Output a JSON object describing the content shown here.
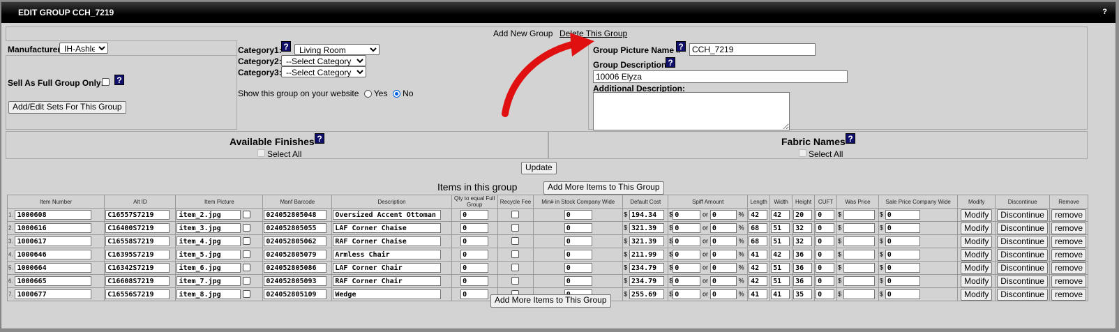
{
  "window": {
    "title": "EDIT GROUP CCH_7219",
    "help": "?"
  },
  "top_links": {
    "add_group": "Add New Group",
    "delete_group": "Delete This Group"
  },
  "manufacturer": {
    "label": "Manufacturer",
    "value": "IH-Ashley"
  },
  "categories": [
    {
      "label": "Category1:",
      "value": "Living Room"
    },
    {
      "label": "Category2:",
      "value": "--Select Category"
    },
    {
      "label": "Category3:",
      "value": "--Select Category"
    }
  ],
  "sell_full": {
    "label": "Sell As Full Group Only:"
  },
  "show_website": {
    "label": "Show this group on your website",
    "yes": "Yes",
    "no": "No",
    "selected": "No"
  },
  "add_sets_button": "Add/Edit Sets For This Group",
  "picture_name": {
    "label": "Group Picture Name #",
    "value": "CCH_7219"
  },
  "description": {
    "label": "Group Description:",
    "value": "10006 Elyza"
  },
  "additional": {
    "label": "Additional Description:",
    "value": ""
  },
  "finishes": {
    "title": "Available Finishes",
    "select_all": "Select All"
  },
  "fabrics": {
    "title": "Fabric Names",
    "select_all": "Select All"
  },
  "update_button": "Update",
  "items_section": {
    "title": "Items in this group",
    "add_more": "Add More Items to This Group",
    "add_more_bottom": "Add More Items to This Group"
  },
  "columns": [
    "Item Number",
    "Alt ID",
    "Item Picture",
    "Manf Barcode",
    "Description",
    "Qty to equal Full Group",
    "Recycle Fee",
    "Min# in Stock Company Wide",
    "Default Cost",
    "Spiff Amount",
    "Length",
    "Width",
    "Height",
    "CUFT",
    "Was Price",
    "Sale Price Company Wide",
    "Modify",
    "Discontinue",
    "Remove"
  ],
  "labels": {
    "currency": "$",
    "or": "or",
    "percent": "%",
    "modify": "Modify",
    "discontinue": "Discontinue",
    "remove": "remove"
  },
  "rows": [
    {
      "n": "1.",
      "item": "1000608",
      "alt": "C16557S7219",
      "pic": "item_2.jpg",
      "barcode": "024052805048",
      "desc": "Oversized Accent Ottoman",
      "qty": "0",
      "min": "0",
      "cost": "194.34",
      "spiff": "0",
      "spiff_pct": "0",
      "len": "42",
      "wid": "42",
      "hgt": "20",
      "cuft": "0",
      "was": "",
      "sale": "0"
    },
    {
      "n": "2.",
      "item": "1000616",
      "alt": "C16400S7219",
      "pic": "item_3.jpg",
      "barcode": "024052805055",
      "desc": "LAF Corner Chaise",
      "qty": "0",
      "min": "0",
      "cost": "321.39",
      "spiff": "0",
      "spiff_pct": "0",
      "len": "68",
      "wid": "51",
      "hgt": "32",
      "cuft": "0",
      "was": "",
      "sale": "0"
    },
    {
      "n": "3.",
      "item": "1000617",
      "alt": "C16558S7219",
      "pic": "item_4.jpg",
      "barcode": "024052805062",
      "desc": "RAF Corner Chaise",
      "qty": "0",
      "min": "0",
      "cost": "321.39",
      "spiff": "0",
      "spiff_pct": "0",
      "len": "68",
      "wid": "51",
      "hgt": "32",
      "cuft": "0",
      "was": "",
      "sale": "0"
    },
    {
      "n": "4.",
      "item": "1000646",
      "alt": "C16395S7219",
      "pic": "item_5.jpg",
      "barcode": "024052805079",
      "desc": "Armless Chair",
      "qty": "0",
      "min": "0",
      "cost": "211.99",
      "spiff": "0",
      "spiff_pct": "0",
      "len": "41",
      "wid": "42",
      "hgt": "36",
      "cuft": "0",
      "was": "",
      "sale": "0"
    },
    {
      "n": "5.",
      "item": "1000664",
      "alt": "C16342S7219",
      "pic": "item_6.jpg",
      "barcode": "024052805086",
      "desc": "LAF Corner Chair",
      "qty": "0",
      "min": "0",
      "cost": "234.79",
      "spiff": "0",
      "spiff_pct": "0",
      "len": "42",
      "wid": "51",
      "hgt": "36",
      "cuft": "0",
      "was": "",
      "sale": "0"
    },
    {
      "n": "6.",
      "item": "1000665",
      "alt": "C16608S7219",
      "pic": "item_7.jpg",
      "barcode": "024052805093",
      "desc": "RAF Corner Chair",
      "qty": "0",
      "min": "0",
      "cost": "234.79",
      "spiff": "0",
      "spiff_pct": "0",
      "len": "42",
      "wid": "51",
      "hgt": "36",
      "cuft": "0",
      "was": "",
      "sale": "0"
    },
    {
      "n": "7.",
      "item": "1000677",
      "alt": "C16556S7219",
      "pic": "item_8.jpg",
      "barcode": "024052805109",
      "desc": "Wedge",
      "qty": "0",
      "min": "0",
      "cost": "255.69",
      "spiff": "0",
      "spiff_pct": "0",
      "len": "41",
      "wid": "41",
      "hgt": "35",
      "cuft": "0",
      "was": "",
      "sale": "0"
    }
  ],
  "colors": {
    "arrow": "#e01010",
    "help_bg": "#10106b",
    "titlebar": "#000000"
  }
}
